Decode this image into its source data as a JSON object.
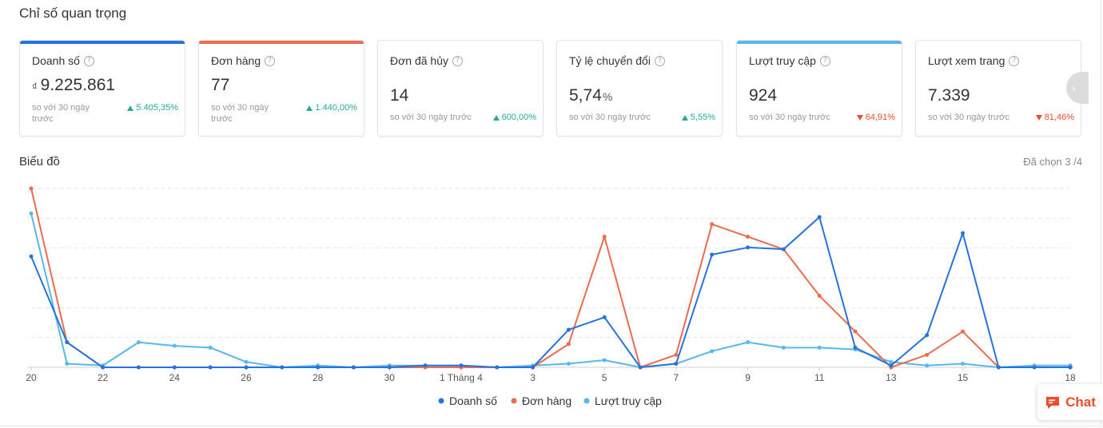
{
  "section_title": "Chỉ số quan trọng",
  "help_glyph": "?",
  "cards": [
    {
      "name": "Doanh số",
      "currency": "₫",
      "value": "9.225.861",
      "unit": "",
      "compare": "so với 30 ngày trước",
      "change": "5.405,35%",
      "direction": "up",
      "bar_color": "#2673dd"
    },
    {
      "name": "Đơn hàng",
      "currency": "",
      "value": "77",
      "unit": "",
      "compare": "so với 30 ngày trước",
      "change": "1.440,00%",
      "direction": "up",
      "bar_color": "#ee6b4d"
    },
    {
      "name": "Đơn đã hủy",
      "currency": "",
      "value": "14",
      "unit": "",
      "compare": "so với 30 ngày trước",
      "change": "600,00%",
      "direction": "up",
      "bar_color": ""
    },
    {
      "name": "Tỷ lệ chuyển đổi",
      "currency": "",
      "value": "5,74",
      "unit": "%",
      "compare": "so với 30 ngày trước",
      "change": "5,55%",
      "direction": "up",
      "bar_color": ""
    },
    {
      "name": "Lượt truy cập",
      "currency": "",
      "value": "924",
      "unit": "",
      "compare": "so với 30 ngày trước",
      "change": "64,91%",
      "direction": "down",
      "bar_color": "#57b8ec"
    },
    {
      "name": "Lượt xem trang",
      "currency": "",
      "value": "7.339",
      "unit": "",
      "compare": "so với 30 ngày trước",
      "change": "81,46%",
      "direction": "down",
      "bar_color": ""
    }
  ],
  "next_glyph": "›",
  "chart_title": "Biểu đồ",
  "chart_selected": "Đã chọn 3 /4",
  "chat_label": "Chat",
  "colors": {
    "up": "#26aa99",
    "down": "#ee4d2d",
    "grid": "#e6e6e6"
  },
  "chart_data": {
    "type": "line",
    "x": [
      "20",
      "21",
      "22",
      "23",
      "24",
      "25",
      "26",
      "27",
      "28",
      "29",
      "30",
      "31",
      "1 Tháng 4",
      "2",
      "3",
      "4",
      "5",
      "6",
      "7",
      "8",
      "9",
      "10",
      "11",
      "12",
      "13",
      "14",
      "15",
      "16",
      "17",
      "18"
    ],
    "tick_labels": [
      "20",
      "22",
      "24",
      "26",
      "28",
      "30",
      "1 Tháng 4",
      "3",
      "5",
      "7",
      "9",
      "11",
      "13",
      "15",
      "18"
    ],
    "tick_index": [
      0,
      2,
      4,
      6,
      8,
      10,
      12,
      14,
      16,
      18,
      20,
      22,
      24,
      26,
      29
    ],
    "ylim": [
      0,
      100
    ],
    "grid": true,
    "legend_position": "bottom",
    "series": [
      {
        "name": "Doanh số",
        "color": "#2673dd",
        "values": [
          62,
          14,
          0,
          0,
          0,
          0,
          0,
          0,
          0,
          0,
          0,
          1,
          1,
          0,
          0,
          21,
          28,
          0,
          2,
          63,
          67,
          66,
          84,
          11,
          1,
          18,
          75,
          0,
          0,
          0
        ]
      },
      {
        "name": "Đơn hàng",
        "color": "#ee6b4d",
        "values": [
          100,
          14,
          0,
          0,
          0,
          0,
          0,
          0,
          0,
          0,
          0,
          0,
          0,
          0,
          0,
          13,
          73,
          0,
          7,
          80,
          73,
          66,
          40,
          20,
          0,
          7,
          20,
          0,
          0,
          0
        ]
      },
      {
        "name": "Lượt truy cập",
        "color": "#57b8ec",
        "values": [
          86,
          2,
          1,
          14,
          12,
          11,
          3,
          0,
          1,
          0,
          1,
          1,
          1,
          0,
          1,
          2,
          4,
          0,
          2,
          9,
          14,
          11,
          11,
          10,
          3,
          1,
          2,
          0,
          1,
          1
        ]
      }
    ]
  }
}
